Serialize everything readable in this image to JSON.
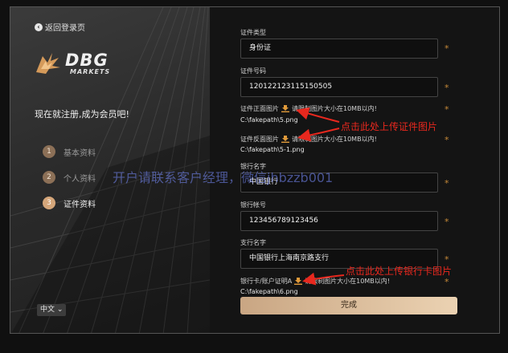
{
  "left": {
    "back_label": "返回登录页",
    "logo_big": "DBG",
    "logo_small": "MARKETS",
    "join_text": "现在就注册,成为会员吧!",
    "steps": [
      {
        "num": "1",
        "label": "基本资料"
      },
      {
        "num": "2",
        "label": "个人资料"
      },
      {
        "num": "3",
        "label": "证件资料"
      }
    ],
    "language": "中文"
  },
  "form": {
    "id_type_label": "证件类型",
    "id_type_value": "身份证",
    "id_number_label": "证件号码",
    "id_number_value": "120122123115150505",
    "front_label": "证件正面图片",
    "front_hint": "请限制图片大小在10MB以内!",
    "front_path": "C:\\fakepath\\5.png",
    "back_label": "证件反面图片",
    "back_hint": "请限制图片大小在10MB以内!",
    "back_path": "C:\\fakepath\\5-1.png",
    "bank_name_label": "银行名字",
    "bank_name_value": "中国银行",
    "bank_account_label": "银行帐号",
    "bank_account_value": "123456789123456",
    "branch_label": "支行名字",
    "branch_value": "中国银行上海南京路支行",
    "bank_card_label": "银行卡/账户证明A",
    "bank_card_hint": "请限制图片大小在10MB以内!",
    "bank_card_path": "C:\\fakepath\\6.png",
    "star": "*",
    "submit_label": "完成"
  },
  "annotations": {
    "id_upload_note": "点击此处上传证件图片",
    "bank_upload_note": "点击此处上传银行卡图片",
    "watermark": "开户请联系客户经理，微信jhbzzb001"
  },
  "colors": {
    "accent": "#d5a67a",
    "star": "#c78a38",
    "annotation_red": "#e8281e"
  }
}
